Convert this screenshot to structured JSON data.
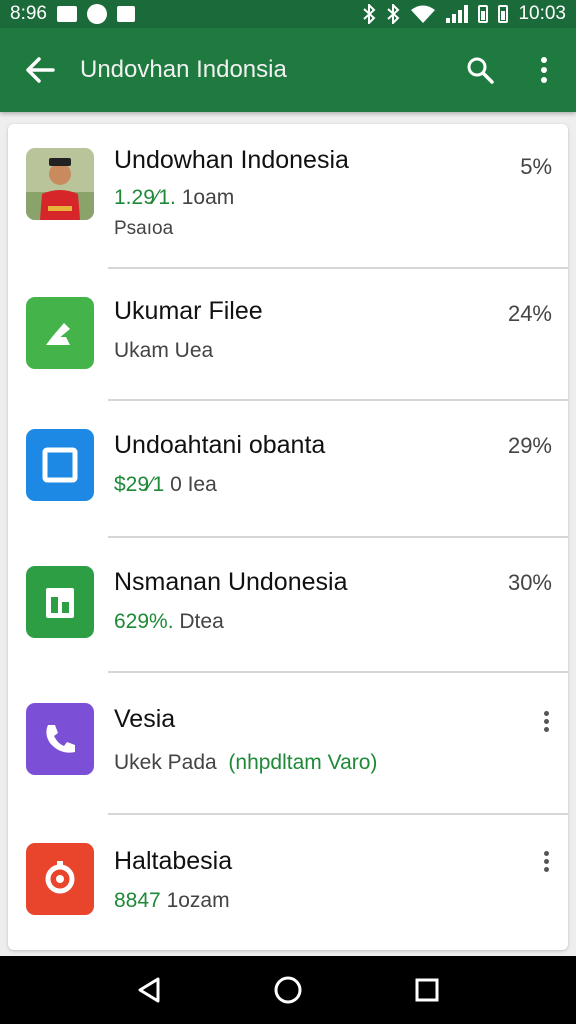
{
  "status_bar": {
    "time_left": "8:96",
    "time_right": "10:03"
  },
  "app_bar": {
    "title": "Undovhan Indonsia"
  },
  "items": [
    {
      "name": "Undowhan Indonesia",
      "sub_green": "1.29⁄1.",
      "sub_gray": "1oam",
      "sub2": "Psaıoa",
      "right": "5%",
      "icon": "person-photo-icon",
      "icon_color": "#c9a066"
    },
    {
      "name": "Ukumar Filee",
      "sub_green": "",
      "sub_gray": "Ukam Uea",
      "right": "24%",
      "icon": "file-icon",
      "icon_color": "#43b34a"
    },
    {
      "name": "Undoahtani obanta",
      "sub_green": "$29⁄1",
      "sub_gray": "0 Iea",
      "right": "29%",
      "icon": "square-icon",
      "icon_color": "#1e88e5"
    },
    {
      "name": "Nsmanan Undonesia",
      "sub_green": "629%.",
      "sub_gray": "Dtea",
      "right": "30%",
      "icon": "sheets-icon",
      "icon_color": "#2e9e44"
    },
    {
      "name": "Vesia",
      "sub_gray": "Ukek Pada",
      "sub_green": "(nhpdltam Varo)",
      "right": "",
      "icon": "phone-icon",
      "icon_color": "#7b4fd6"
    },
    {
      "name": "Haltabesia",
      "sub_green": "8847",
      "sub_gray": "1ozam",
      "right": "",
      "icon": "target-icon",
      "icon_color": "#e8452c"
    }
  ],
  "colors": {
    "status_bar": "#1b6b3a",
    "app_bar": "#1e7a3e",
    "accent_green": "#1e8a38"
  }
}
